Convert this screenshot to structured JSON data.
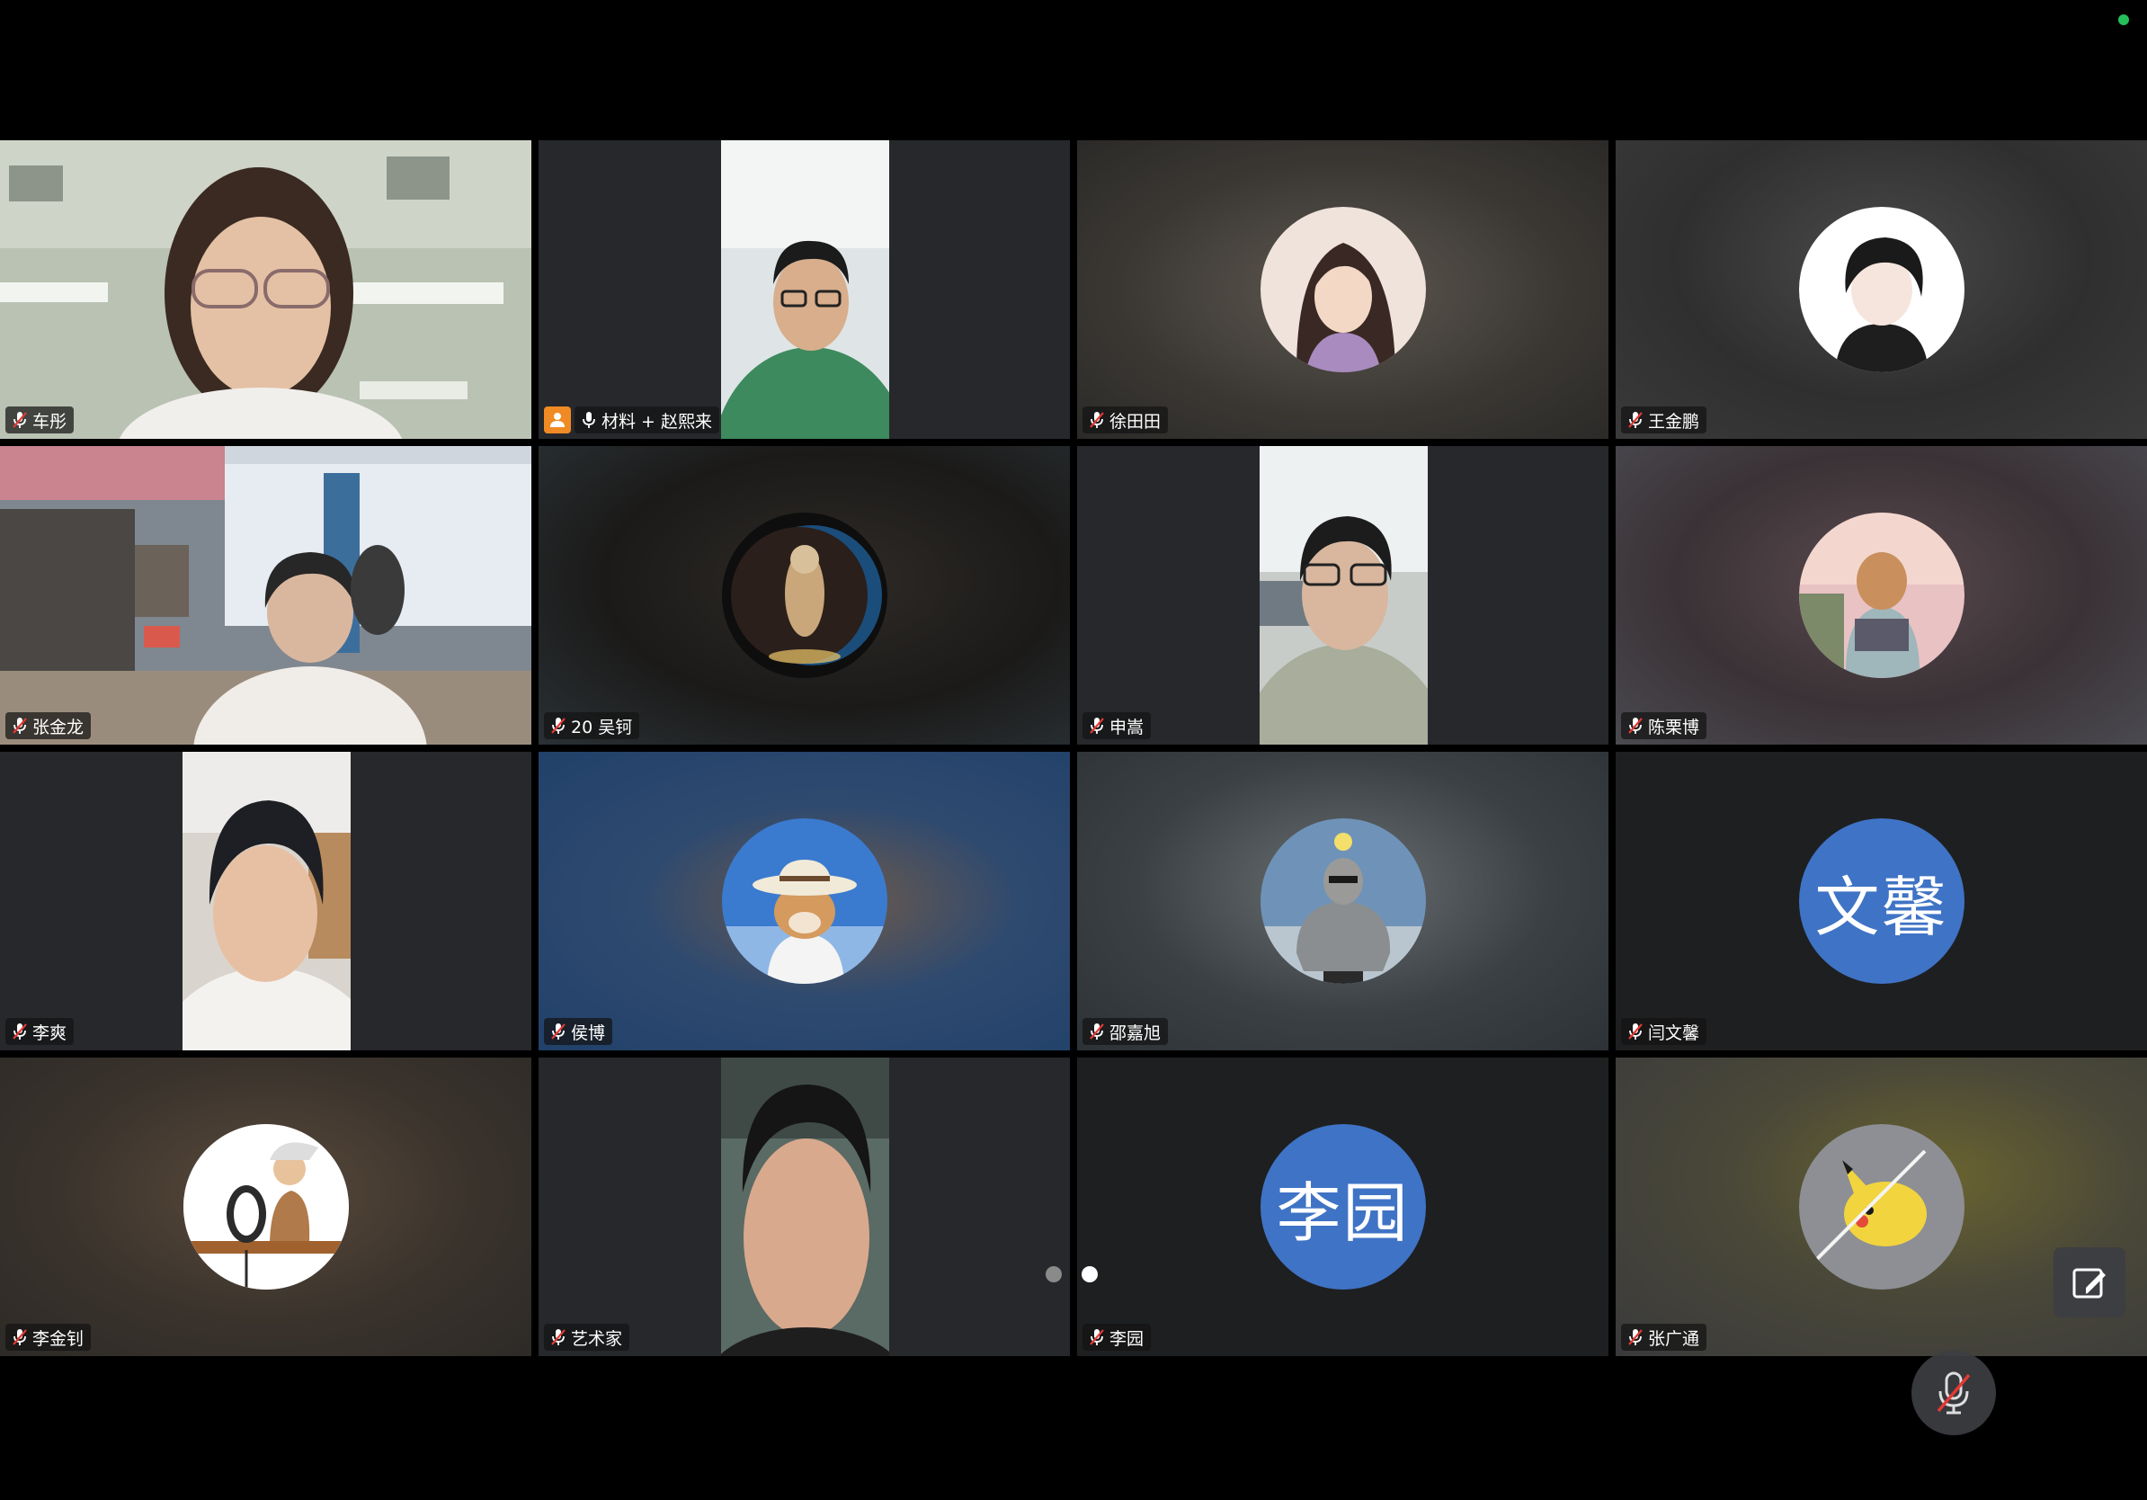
{
  "participants": [
    {
      "name": "车彤",
      "video": "camera",
      "muted": true
    },
    {
      "name": "材料 + 赵熙来",
      "video": "camera-portrait",
      "muted": false,
      "host": true
    },
    {
      "name": "徐田田",
      "video": "avatar",
      "avatar_icon": "illustrated-woman-avatar",
      "muted": true
    },
    {
      "name": "王金鹏",
      "video": "avatar",
      "avatar_icon": "anime-boy-avatar",
      "muted": true
    },
    {
      "name": "张金龙",
      "video": "camera",
      "muted": true
    },
    {
      "name": "20 吴钶",
      "video": "avatar",
      "avatar_icon": "astronaut-portal-avatar",
      "muted": true
    },
    {
      "name": "申嵩",
      "video": "camera-portrait",
      "muted": true
    },
    {
      "name": "陈栗博",
      "video": "avatar",
      "avatar_icon": "anime-boy-backpack-avatar",
      "muted": true
    },
    {
      "name": "李爽",
      "video": "camera-portrait",
      "muted": true
    },
    {
      "name": "侯博",
      "video": "avatar",
      "avatar_icon": "shiba-hat-avatar",
      "muted": true
    },
    {
      "name": "邵嘉旭",
      "video": "avatar",
      "avatar_icon": "sweater-person-avatar",
      "muted": true
    },
    {
      "name": "闫文馨",
      "video": "text-avatar",
      "avatar_text": "文馨",
      "muted": true
    },
    {
      "name": "李金钊",
      "video": "avatar",
      "avatar_icon": "old-man-cartoon-avatar",
      "muted": true
    },
    {
      "name": "艺术家",
      "video": "camera-portrait",
      "muted": true
    },
    {
      "name": "李园",
      "video": "text-avatar",
      "avatar_text": "李园",
      "muted": true
    },
    {
      "name": "张广通",
      "video": "avatar",
      "avatar_icon": "pikachu-plush-avatar",
      "muted": true
    }
  ],
  "pagination": {
    "current_page": 2,
    "total_pages": 2
  },
  "controls": {
    "annotate_icon": "annotate-icon",
    "mute_icon": "mic-muted-icon"
  },
  "colors": {
    "text_avatar_blue": "#3f73c5",
    "host_orange": "#f08a24",
    "muted_red": "#e53935",
    "status_green": "#25c05a"
  }
}
